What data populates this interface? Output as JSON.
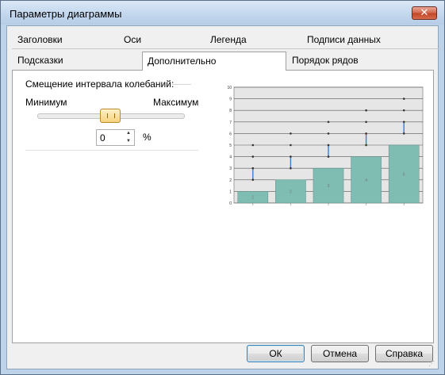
{
  "window": {
    "title": "Параметры диаграммы",
    "close_glyph": "✕"
  },
  "tabs": {
    "row1": [
      "Заголовки",
      "Оси",
      "Легенда",
      "Подписи данных"
    ],
    "row2": [
      "Подсказки",
      "Дополнительно",
      "Порядок рядов"
    ],
    "active": "Дополнительно"
  },
  "interval": {
    "group_label": "Смещение интервала колебаний:",
    "min_label": "Минимум",
    "max_label": "Максимум",
    "slider_value": 0,
    "value": "0",
    "unit": "%"
  },
  "buttons": {
    "ok": "ОК",
    "cancel": "Отмена",
    "help": "Справка"
  },
  "chart_data": {
    "type": "bar",
    "categories": [
      "1",
      "2",
      "3",
      "4",
      "5"
    ],
    "values": [
      1,
      2,
      3,
      4,
      5
    ],
    "ylim": [
      0,
      10
    ],
    "yticks": [
      "0",
      "1",
      "2",
      "3",
      "4",
      "5",
      "6",
      "7",
      "8",
      "9",
      "10"
    ],
    "grid": true,
    "bar_color": "#7fbcb2",
    "range_lines": [
      {
        "x": 1,
        "low": 2,
        "high": 3,
        "markers": [
          2,
          3,
          4,
          5
        ]
      },
      {
        "x": 2,
        "low": 3,
        "high": 4,
        "markers": [
          3,
          4,
          5,
          6
        ]
      },
      {
        "x": 3,
        "low": 4,
        "high": 5,
        "markers": [
          4,
          5,
          6,
          7
        ]
      },
      {
        "x": 4,
        "low": 5,
        "high": 6,
        "markers": [
          5,
          6,
          7,
          8
        ]
      },
      {
        "x": 5,
        "low": 6,
        "high": 7,
        "markers": [
          6,
          7,
          8,
          9
        ]
      }
    ],
    "range_color": "#3b7bd6"
  }
}
